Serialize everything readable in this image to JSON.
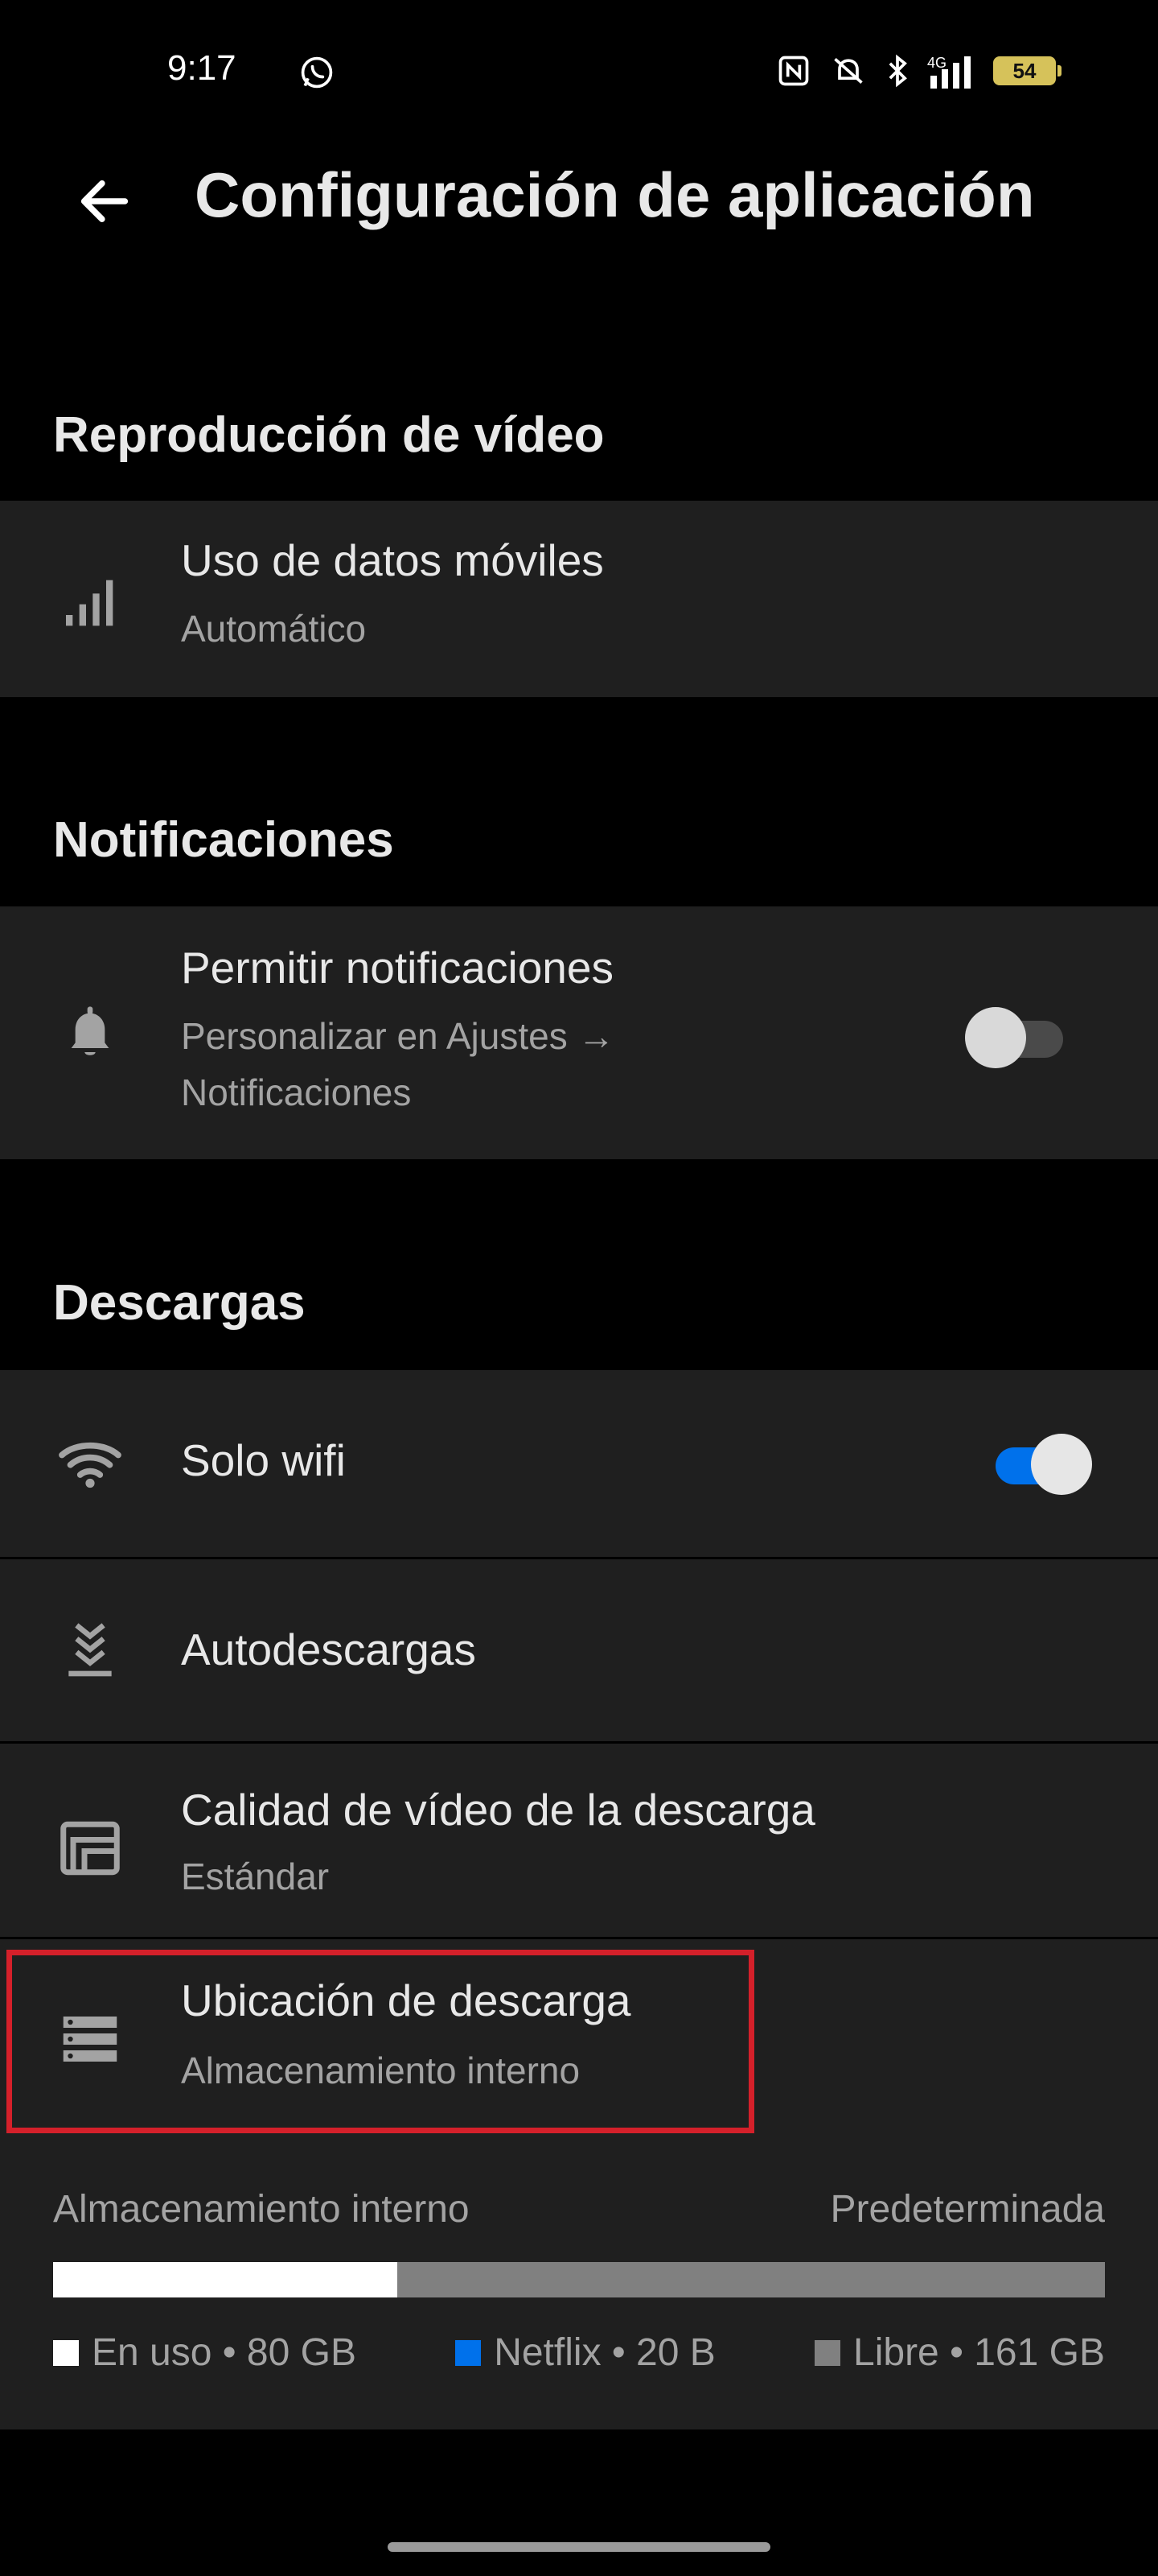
{
  "status_bar": {
    "time": "9:17",
    "battery": "54",
    "network": "4G"
  },
  "header": {
    "title": "Configuración de aplicación"
  },
  "sections": {
    "video": {
      "title": "Reproducción de vídeo",
      "mobile_data": {
        "title": "Uso de datos móviles",
        "subtitle": "Automático"
      }
    },
    "notifications": {
      "title": "Notificaciones",
      "allow": {
        "title": "Permitir notificaciones",
        "subtitle_line1": "Personalizar en Ajustes →",
        "subtitle_line2": "Notificaciones",
        "toggle_on": false
      }
    },
    "downloads": {
      "title": "Descargas",
      "wifi_only": {
        "title": "Solo wifi",
        "toggle_on": true
      },
      "auto_downloads": {
        "title": "Autodescargas"
      },
      "video_quality": {
        "title": "Calidad de vídeo de la descarga",
        "subtitle": "Estándar"
      },
      "location": {
        "title": "Ubicación de descarga",
        "subtitle": "Almacenamiento interno"
      }
    }
  },
  "storage": {
    "label": "Almacenamiento interno",
    "default_label": "Predeterminada",
    "used_fraction": 0.327,
    "netflix_fraction": 0.0,
    "legend": {
      "used": "En uso • 80 GB",
      "netflix": "Netflix • 20 B",
      "free": "Libre • 161 GB"
    }
  },
  "colors": {
    "accent_blue": "#0071eb",
    "highlight_red": "#d4202a",
    "card_bg": "#1f1f1f"
  }
}
